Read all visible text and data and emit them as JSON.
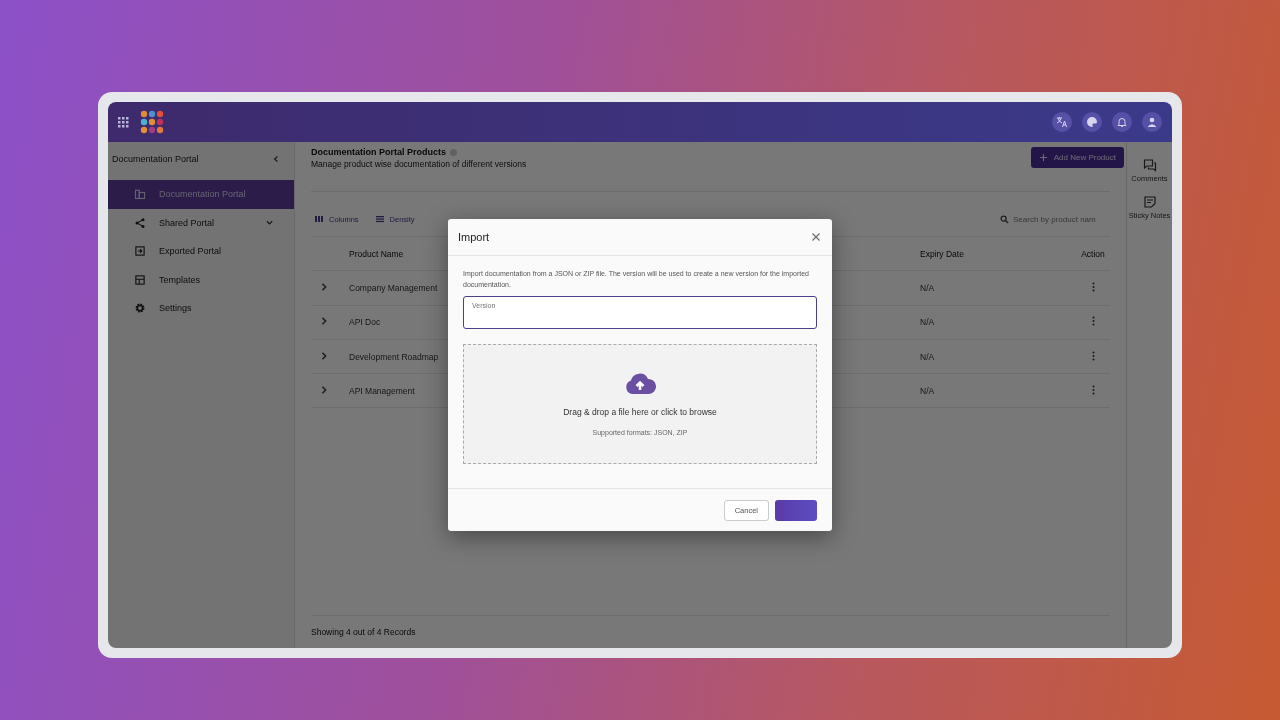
{
  "sidebar": {
    "title": "Documentation Portal",
    "items": [
      {
        "label": "Documentation Portal",
        "kind": "docs",
        "selected": true
      },
      {
        "label": "Shared Portal",
        "kind": "share",
        "selected": false,
        "expanded": false
      },
      {
        "label": "Exported Portal",
        "kind": "export",
        "selected": false
      },
      {
        "label": "Templates",
        "kind": "templates",
        "selected": false
      },
      {
        "label": "Settings",
        "kind": "settings",
        "selected": false
      }
    ]
  },
  "page": {
    "title": "Documentation Portal Products",
    "subtitle": "Manage product wise documentation of different versions",
    "add_button": "Add New Product"
  },
  "toolbar": {
    "buttons": [
      {
        "label": "Columns",
        "kind": "columns"
      },
      {
        "label": "Density",
        "kind": "density"
      }
    ],
    "search": {
      "placeholder": "Search by product nam"
    }
  },
  "table": {
    "columns": [
      "Product Name",
      "Expiry Date",
      "Action"
    ],
    "rows": [
      {
        "product_name": "Company Management",
        "expiry_date": "N/A",
        "expanded": false
      },
      {
        "product_name": "API Doc",
        "expiry_date": "N/A",
        "expanded": false
      },
      {
        "product_name": "Development Roadmap",
        "expiry_date": "N/A",
        "expanded": false
      },
      {
        "product_name": "API Management",
        "expiry_date": "N/A",
        "expanded": false
      }
    ]
  },
  "footer": "Showing 4 out of 4 Records",
  "right_rail": [
    {
      "label": "Comments",
      "kind": "comments"
    },
    {
      "label": "Sticky Notes",
      "kind": "notes"
    }
  ],
  "dialog": {
    "title": "Import",
    "description": "Import documentation from a JSON or ZIP file. The version will be used to create a new version for the imported documentation.",
    "version_field": {
      "label": "Version",
      "focused": true
    },
    "dropzone": {
      "text": "Drag & drop a file here or click to browse",
      "hint": "Supported formats: JSON, ZIP"
    },
    "buttons": [
      {
        "label": "Cancel",
        "kind": "secondary"
      },
      {
        "kind": "primary"
      }
    ]
  }
}
